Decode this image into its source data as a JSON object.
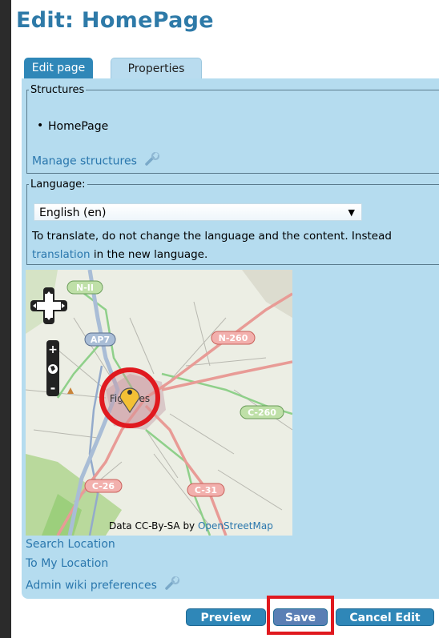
{
  "page": {
    "title": "Edit: HomePage"
  },
  "tabs": [
    {
      "label": "Edit page"
    },
    {
      "label": "Properties"
    }
  ],
  "structures": {
    "legend": "Structures",
    "items": [
      "HomePage"
    ],
    "manage_link": "Manage structures"
  },
  "language": {
    "legend": "Language:",
    "selected": "English (en)",
    "instruction": "To translate, do not change the language and the content. Instead",
    "translation_link": "translation",
    "instruction_suffix": " in the new language."
  },
  "map": {
    "labels": {
      "n2": "N-II",
      "ap7": "AP7",
      "n260": "N-260",
      "c260": "C-260",
      "c26": "C-26",
      "c31": "C-31",
      "city": "Figueres"
    },
    "attribution_prefix": "Data CC-By-SA by ",
    "attribution_link": "OpenStreetMap"
  },
  "links": {
    "search_location": "Search Location",
    "to_my_location": "To My Location",
    "admin_prefs": "Admin wiki preferences"
  },
  "buttons": {
    "preview": "Preview",
    "save": "Save",
    "cancel": "Cancel Edit"
  },
  "colors": {
    "accent": "#2f87b8",
    "panel": "#b5dcef",
    "highlight": "#e0191f",
    "title": "#2e7aa8"
  }
}
